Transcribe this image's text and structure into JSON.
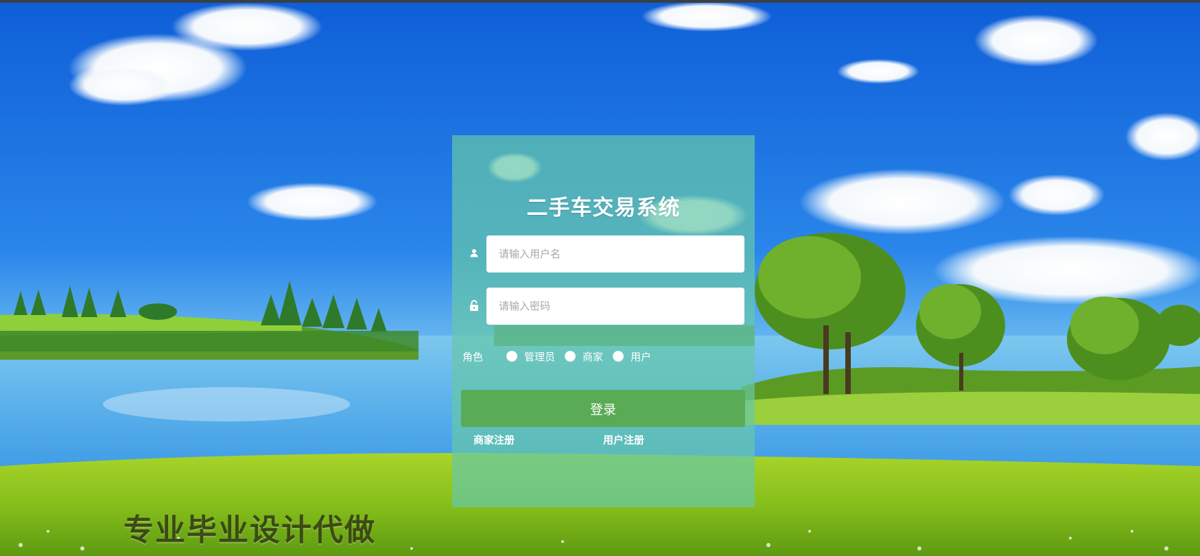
{
  "login": {
    "title": "二手车交易系统",
    "username_placeholder": "请输入用户名",
    "password_placeholder": "请输入密码",
    "role_label": "角色",
    "roles": [
      "管理员",
      "商家",
      "用户"
    ],
    "login_button": "登录",
    "merchant_register": "商家注册",
    "user_register": "用户注册"
  },
  "watermark": "专业毕业设计代做",
  "colors": {
    "panel": "#66c8a8",
    "button": "#59ab55",
    "sky": "#1d6fe0",
    "grass": "#8cc21c"
  },
  "icons": [
    "user-icon",
    "lock-icon"
  ]
}
